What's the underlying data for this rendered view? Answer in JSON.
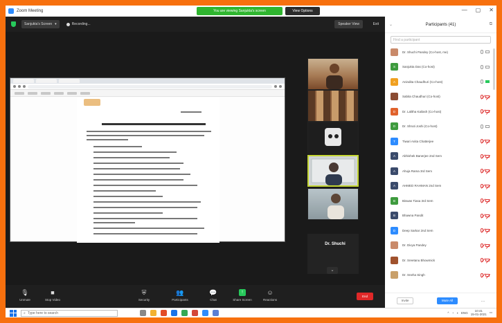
{
  "window": {
    "title": "Zoom Meeting",
    "sharing_banner": "You are viewing Sanjukta's screen",
    "view_options": "View Options",
    "controls": [
      "—",
      "▢",
      "✕"
    ]
  },
  "topbar": {
    "share_select": "Sanjukta's Screen",
    "recording": "Recording...",
    "speaker_view": "Speaker View",
    "full_view": "Exit"
  },
  "thumbnails": {
    "active_name": "Dr. Shuchi",
    "more_arrow": "⌄"
  },
  "toolbar": {
    "items": [
      {
        "label": "Unmute",
        "icon": "microphone-icon",
        "glyph": "🎙"
      },
      {
        "label": "Stop Video",
        "icon": "video-icon",
        "glyph": "■"
      },
      {
        "label": "Security",
        "icon": "shield-icon",
        "glyph": "⛨"
      },
      {
        "label": "Participants",
        "icon": "participants-icon",
        "glyph": "👥"
      },
      {
        "label": "Chat",
        "icon": "chat-icon",
        "glyph": "💬"
      },
      {
        "label": "Share Screen",
        "icon": "share-screen-icon",
        "glyph": "↑"
      },
      {
        "label": "Reactions",
        "icon": "reactions-icon",
        "glyph": "☺"
      }
    ],
    "end": "End"
  },
  "participants": {
    "title": "Participants (41)",
    "search_placeholder": "Find a participant",
    "list": [
      {
        "name": "Dr. Shuchi Pandey (Co-host, me)",
        "avatar_text": "",
        "color": "#c98a6a",
        "mic": "gray",
        "cam": "gray"
      },
      {
        "name": "Sanjukta Das (Co-host)",
        "avatar_text": "S",
        "color": "#3e9b3e",
        "mic": "gray",
        "cam": "gray"
      },
      {
        "name": "Anindita Chaudhuri (Co-host)",
        "avatar_text": "A",
        "color": "#f0a020",
        "mic": "gray",
        "cam": "green"
      },
      {
        "name": "Sabita Chaudhuri (Co-host)",
        "avatar_text": "",
        "color": "#8a4b32",
        "mic": "red",
        "cam": "red"
      },
      {
        "name": "Dr. Lalitha Kailash (Co-host)",
        "avatar_text": "D",
        "color": "#e0622c",
        "mic": "red",
        "cam": "red"
      },
      {
        "name": "Dr. Shruti Joshi (Co-host)",
        "avatar_text": "D",
        "color": "#3e9b3e",
        "mic": "gray",
        "cam": "gray"
      },
      {
        "name": "Tiwari Anita Chatterjee",
        "avatar_text": "T",
        "color": "#2d8cff",
        "mic": "red",
        "cam": "red"
      },
      {
        "name": "Abhishek Banerjee 2nd Sem",
        "avatar_text": "A",
        "color": "#3a4a6b",
        "mic": "red",
        "cam": "red"
      },
      {
        "name": "Ahuja Rama 3rd Sem",
        "avatar_text": "A",
        "color": "#3a4a6b",
        "mic": "red",
        "cam": "red"
      },
      {
        "name": "AHMED RAHMAN 2nd Sem",
        "avatar_text": "A",
        "color": "#3a4a6b",
        "mic": "red",
        "cam": "red"
      },
      {
        "name": "Biswas Tiasa 3rd Sem",
        "avatar_text": "B",
        "color": "#3e9b3e",
        "mic": "red",
        "cam": "red"
      },
      {
        "name": "Bhawna Pandit",
        "avatar_text": "B",
        "color": "#3a4a6b",
        "mic": "red",
        "cam": "red"
      },
      {
        "name": "Deep Sarkar 2nd Sem",
        "avatar_text": "D",
        "color": "#2d8cff",
        "mic": "red",
        "cam": "red"
      },
      {
        "name": "Dr. Divya Pandey",
        "avatar_text": "",
        "color": "#c98a6a",
        "mic": "red",
        "cam": "red"
      },
      {
        "name": "Dr. Sreetanu Bhowmick",
        "avatar_text": "",
        "color": "#a0522d",
        "mic": "red",
        "cam": "red"
      },
      {
        "name": "Dr. Sneha Singh",
        "avatar_text": "",
        "color": "#c9a06a",
        "mic": "red",
        "cam": "red"
      }
    ],
    "footer": {
      "invite": "Invite",
      "mute_all": "Mute All",
      "more": "..."
    }
  },
  "taskbar": {
    "search_text": "Type here to search",
    "time": "10:41",
    "date": "15-01-2021",
    "lang": "ENG"
  },
  "colors": {
    "frame": "#f7700e",
    "accent": "#2d8cff",
    "share_green": "#27c95b",
    "end_red": "#e02828",
    "active_thumb": "#c3d531"
  }
}
